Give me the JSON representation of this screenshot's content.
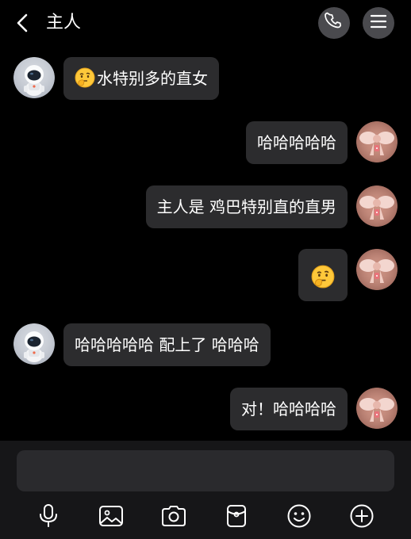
{
  "header": {
    "title": "主人",
    "icons": {
      "back": "chevron-left-icon",
      "call": "phone-icon",
      "menu": "menu-icon"
    }
  },
  "messages": [
    {
      "side": "left",
      "emoji": "thinking-face-emoji",
      "text": "水特别多的直女"
    },
    {
      "side": "right",
      "text": "哈哈哈哈哈"
    },
    {
      "side": "right",
      "text": "主人是 鸡巴特别直的直男"
    },
    {
      "side": "right",
      "emoji": "thinking-face-emoji",
      "text": ""
    },
    {
      "side": "left",
      "text": "哈哈哈哈哈 配上了 哈哈哈"
    },
    {
      "side": "right",
      "text": "对！哈哈哈哈"
    }
  ],
  "composer": {
    "placeholder": "",
    "tools": [
      "microphone-icon",
      "image-icon",
      "camera-icon",
      "red-packet-icon",
      "emoji-icon",
      "plus-icon"
    ]
  },
  "colors": {
    "background": "#000000",
    "bubble": "#2c2c2e",
    "bottom_bar": "#161618",
    "input": "#2a2a2d",
    "header_button": "#4a4a4e"
  }
}
